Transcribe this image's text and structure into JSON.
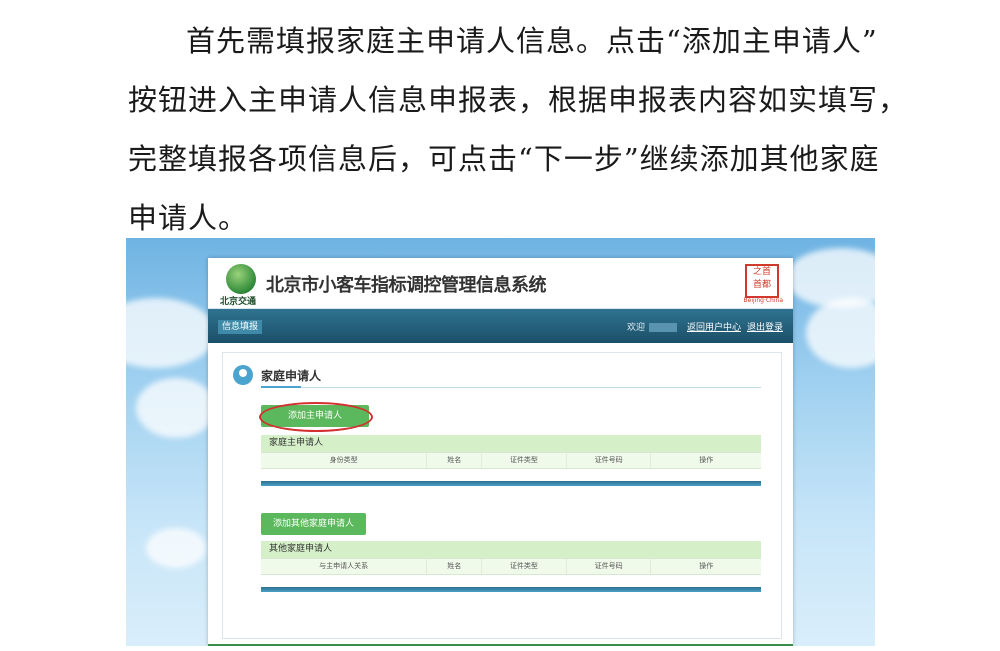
{
  "paragraph": {
    "line1": "首先需填报家庭主申请人信息。点击“添加主申请人”",
    "line2": "按钮进入主申请人信息申报表，根据申报表内容如实填写，",
    "line3": "完整填报各项信息后，可点击“下一步”继续添加其他家庭",
    "line4": "申请人。"
  },
  "app": {
    "logo_text": "北京交通",
    "title": "北京市小客车指标调控管理信息系统",
    "seal_top": "之首",
    "seal_bottom": "首都",
    "seal_sub": "Beijing·China",
    "nav_tab": "信息填报",
    "welcome": "欢迎",
    "return_link": "返回用户中心",
    "logout_link": "退出登录"
  },
  "section": {
    "title": "家庭申请人",
    "add_main_button": "添加主申请人",
    "main_table": {
      "title": "家庭主申请人",
      "columns": [
        "身份类型",
        "姓名",
        "证件类型",
        "证件号码",
        "操作"
      ]
    },
    "add_other_button": "添加其他家庭申请人",
    "other_table": {
      "title": "其他家庭申请人",
      "columns": [
        "与主申请人关系",
        "姓名",
        "证件类型",
        "证件号码",
        "操作"
      ]
    }
  },
  "colors": {
    "nav": "#1c4f68",
    "button": "#5cb85c",
    "highlight": "#d32f2f",
    "table_header": "#d5f0c8"
  }
}
